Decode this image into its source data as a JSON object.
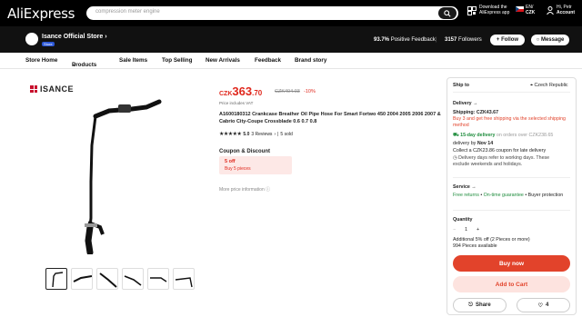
{
  "header": {
    "logo": "AliExpress",
    "search_placeholder": "compression meter engine",
    "download_line1": "Download the",
    "download_line2": "AliExpress app",
    "lang_line1": "EN/",
    "lang_line2": "CZK",
    "user_line1": "Hi, Petr",
    "user_line2": "Account"
  },
  "seller": {
    "store_name": "Isance Official Store",
    "store_badge": "Store",
    "positive_value": "93.7%",
    "positive_label": "Positive Feedback",
    "followers_value": "3157",
    "followers_label": "Followers",
    "follow_label": "Follow",
    "message_label": "Message"
  },
  "storenav": [
    "Store Home",
    "Products",
    "Sale Items",
    "Top Selling",
    "New Arrivals",
    "Feedback",
    "Brand story"
  ],
  "gallery": {
    "brand": "ISANCE"
  },
  "product": {
    "currency": "CZK",
    "price_main": "363",
    "price_dec": ".70",
    "price_old": "CZK404.03",
    "discount": "-10%",
    "vat_note": "Price includes VAT",
    "title": "A1600180312 Crankcase Breather Oil Pipe Hose For Smart Fortwo 450 2004 2005 2006 2007 & Cabrio City-Coupe Crossblade 0.6 0.7 0.8",
    "rating": "5.0",
    "reviews": "3 Reviews",
    "sold": "5 sold",
    "coupon_heading": "Coupon & Discount",
    "coupon_off": "5 off",
    "coupon_cond": "Buy 5 pieces",
    "more_price": "More price information"
  },
  "shipping": {
    "ship_to_label": "Ship to",
    "ship_to_country": "Czech Republic",
    "delivery_heading": "Delivery",
    "shipping_cost": "Shipping: CZK43.67",
    "free_ship_note": "Buy 3 and get free shipping via the selected shipping method",
    "delivery_15": "15-day delivery",
    "delivery_15_rest": "on orders over CZK238.65",
    "delivery_by_label": "delivery by",
    "delivery_by_date": "Nov 14",
    "late_note": "Collect a CZK23.86 coupon for late delivery",
    "refer_note": "Delivery days refer to working days. These exclude weekends and holidays.",
    "service_heading": "Service",
    "service_line": "Free returns",
    "service_guarantee": "On-time guarantee",
    "service_buyer": "Buyer protection",
    "quantity_heading": "Quantity",
    "quantity_value": "1",
    "extra_discount": "Additional 5% off (2 Pieces or more)",
    "available": "994 Pieces available",
    "buy_now": "Buy now",
    "add_to_cart": "Add to Cart",
    "share": "Share",
    "wish_count": "4"
  },
  "colors": {
    "accent": "#e2432b",
    "price_red": "#e0281d",
    "green": "#1e8c3c",
    "topbar": "#000000"
  }
}
